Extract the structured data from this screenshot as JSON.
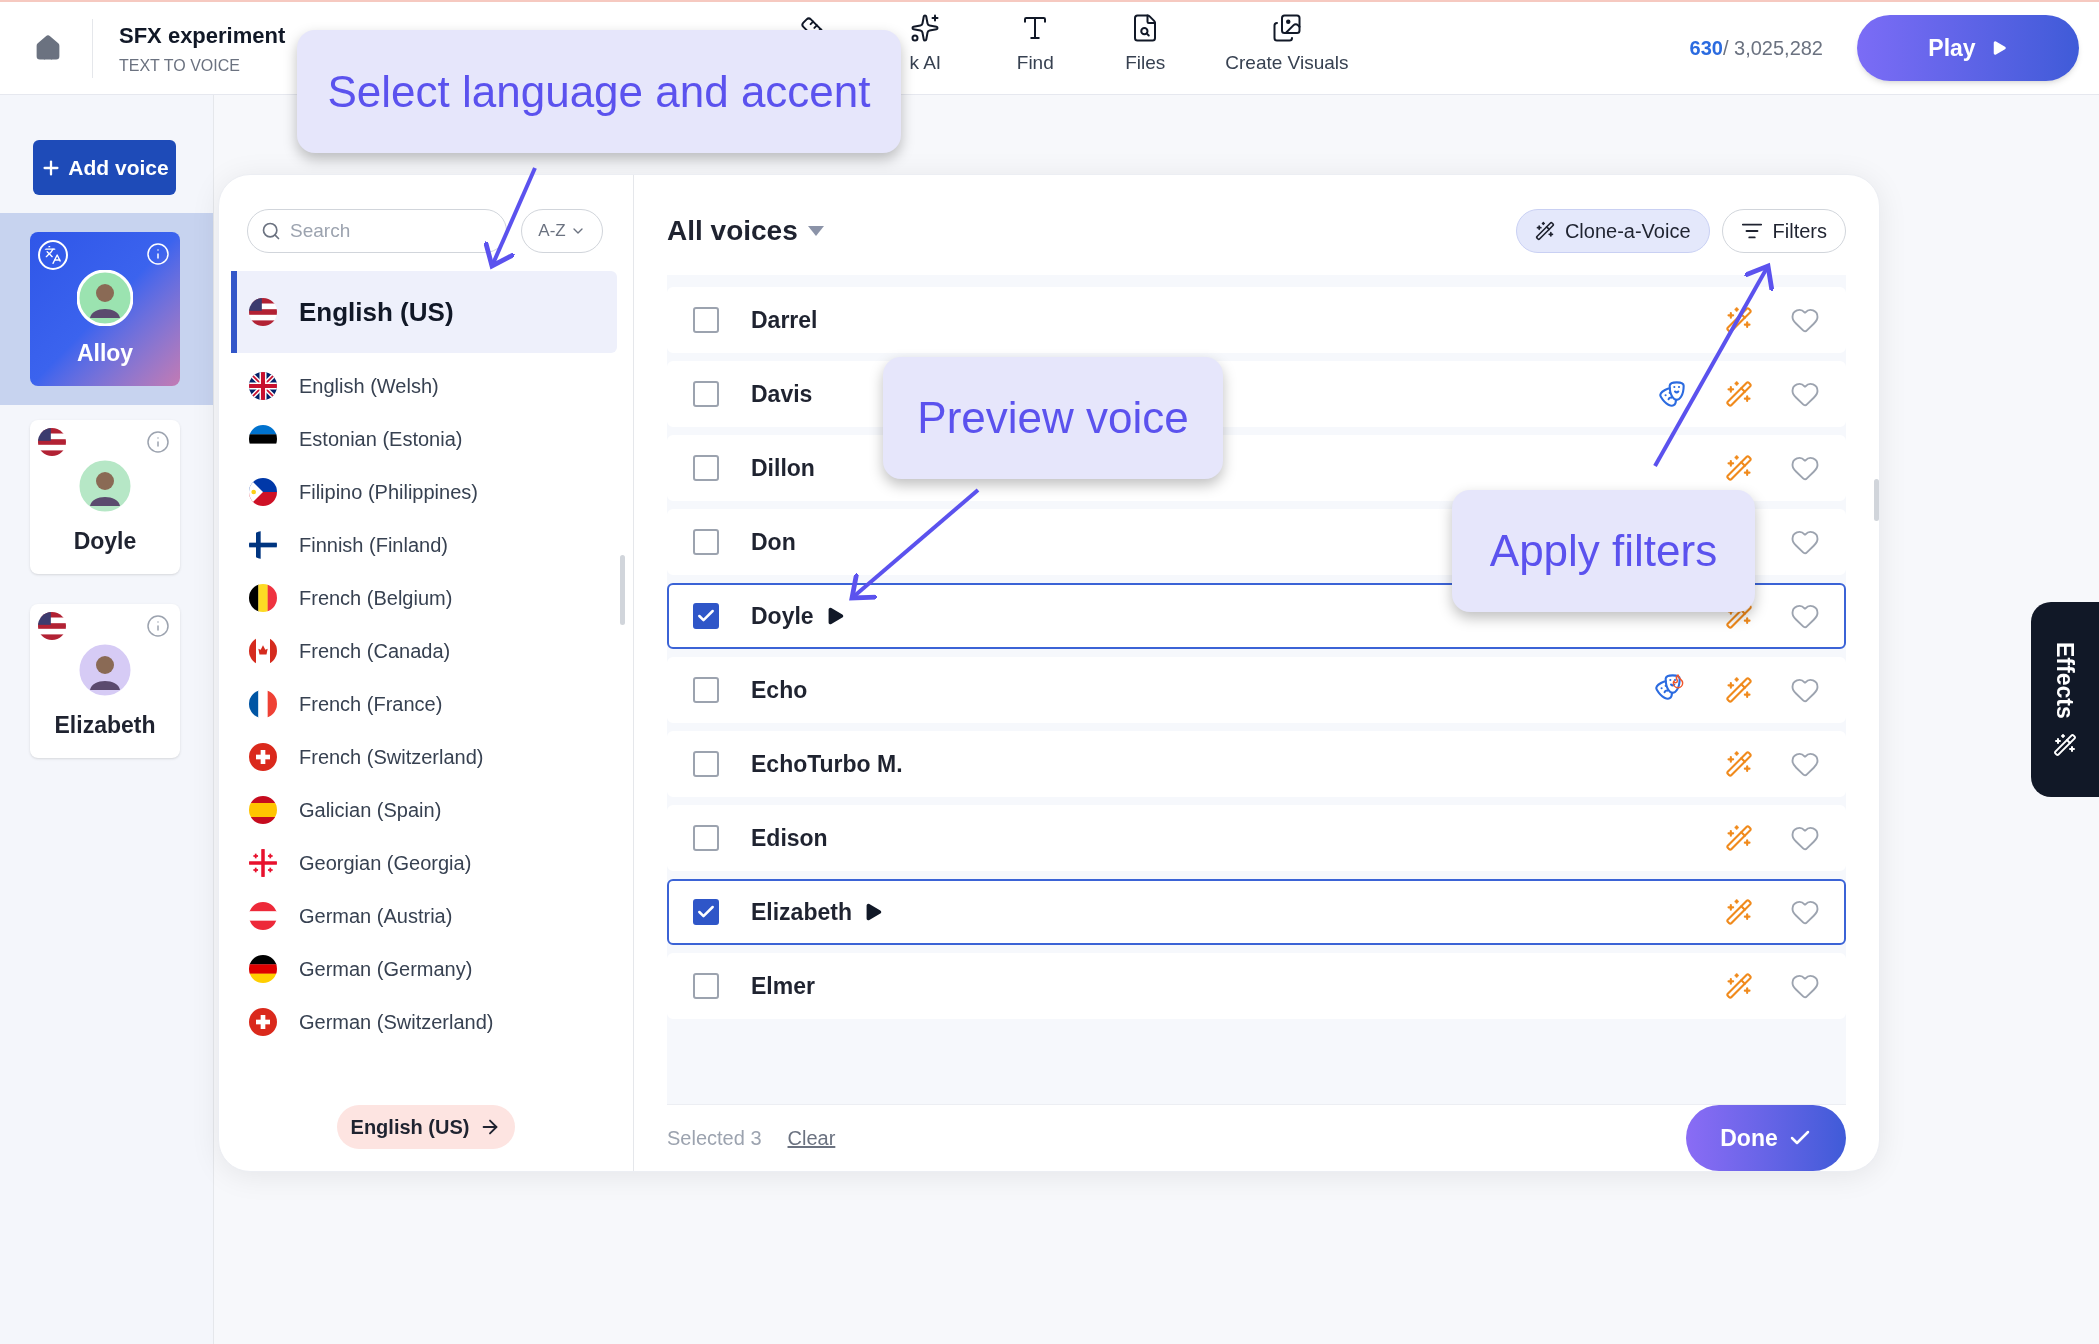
{
  "header": {
    "title": "SFX experiment",
    "subtitle": "TEXT TO VOICE",
    "nav": [
      {
        "kind": "ruler"
      },
      {
        "kind": "sparkle",
        "label": "k AI"
      },
      {
        "kind": "find",
        "label": "Find"
      },
      {
        "kind": "files",
        "label": "Files"
      },
      {
        "kind": "visuals",
        "label": "Create Visuals"
      }
    ],
    "credits_used": "630",
    "credits_total": "/ 3,025,282",
    "play_button": "Play"
  },
  "sidebar": {
    "add_button": "Add voice",
    "voices": [
      {
        "name": "Alloy",
        "selected": true,
        "kind": "translate"
      },
      {
        "name": "Doyle",
        "selected": false,
        "kind": "flag"
      },
      {
        "name": "Elizabeth",
        "selected": false,
        "kind": "flag"
      }
    ]
  },
  "languages": {
    "search_placeholder": "Search",
    "sort": "A-Z",
    "current": "English (US)",
    "items": [
      {
        "label": "English (US)",
        "selected": true
      },
      {
        "label": "English (Welsh)",
        "selected": false
      },
      {
        "label": "Estonian (Estonia)",
        "selected": false
      },
      {
        "label": "Filipino (Philippines)",
        "selected": false
      },
      {
        "label": "Finnish (Finland)",
        "selected": false
      },
      {
        "label": "French (Belgium)",
        "selected": false
      },
      {
        "label": "French (Canada)",
        "selected": false
      },
      {
        "label": "French (France)",
        "selected": false
      },
      {
        "label": "French (Switzerland)",
        "selected": false
      },
      {
        "label": "Galician (Spain)",
        "selected": false
      },
      {
        "label": "Georgian (Georgia)",
        "selected": false
      },
      {
        "label": "German (Austria)",
        "selected": false
      },
      {
        "label": "German (Germany)",
        "selected": false
      },
      {
        "label": "German (Switzerland)",
        "selected": false
      }
    ]
  },
  "voices": {
    "title": "All voices",
    "clone_button": "Clone-a-Voice",
    "filters_button": "Filters",
    "rows": [
      {
        "name": "Darrel",
        "checked": false,
        "kind": "plain",
        "wand": true
      },
      {
        "name": "Davis",
        "checked": false,
        "kind": "mask",
        "wand": true
      },
      {
        "name": "Dillon",
        "checked": false,
        "kind": "plain",
        "wand": true
      },
      {
        "name": "Don",
        "checked": false,
        "kind": "plain",
        "wand": false
      },
      {
        "name": "Doyle",
        "checked": true,
        "kind": "plain",
        "wand": true
      },
      {
        "name": "Echo",
        "checked": false,
        "kind": "mask-fire",
        "wand": true
      },
      {
        "name": "EchoTurbo M.",
        "checked": false,
        "kind": "plain",
        "wand": true
      },
      {
        "name": "Edison",
        "checked": false,
        "kind": "plain",
        "wand": true
      },
      {
        "name": "Elizabeth",
        "checked": true,
        "kind": "plain",
        "wand": true
      },
      {
        "name": "Elmer",
        "checked": false,
        "kind": "plain",
        "wand": true
      }
    ],
    "selected_count": "Selected 3",
    "clear": "Clear",
    "done_button": "Done"
  },
  "effects_tab": "Effects",
  "annotations": [
    {
      "text": "Select language and accent"
    },
    {
      "text": "Preview voice"
    },
    {
      "text": "Apply filters"
    }
  ]
}
